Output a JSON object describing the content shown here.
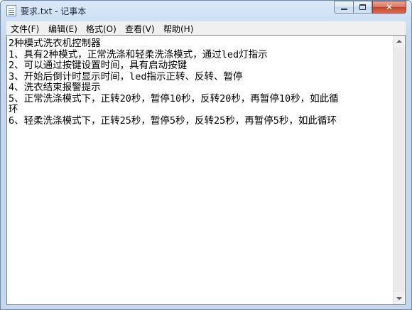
{
  "window": {
    "title": "要求.txt - 记事本",
    "controls": {
      "minimize": "minimize-icon",
      "maximize": "maximize-icon",
      "close": "close-icon",
      "close_glyph": "✕"
    }
  },
  "menu": {
    "items": [
      {
        "label": "文件(F)"
      },
      {
        "label": "编辑(E)"
      },
      {
        "label": "格式(O)"
      },
      {
        "label": "查看(V)"
      },
      {
        "label": "帮助(H)"
      }
    ]
  },
  "document": {
    "lines": [
      "2种模式洗衣机控制器",
      "1、具有2种模式，正常洗涤和轻柔洗涤模式，通过led灯指示",
      "2、可以通过按键设置时间，具有启动按键",
      "3、开始后倒计时显示时间，led指示正转、反转、暂停",
      "4、洗衣结束报警提示",
      "5、正常洗涤模式下，正转20秒，暂停10秒，反转20秒，再暂停10秒，如此循",
      "环",
      "6、轻柔洗涤模式下，正转25秒，暂停5秒，反转25秒，再暂停5秒，如此循环"
    ]
  },
  "colors": {
    "title_bar": "#cddff2",
    "close_button": "#c2452d",
    "menu_bar": "#f0f0f0"
  }
}
